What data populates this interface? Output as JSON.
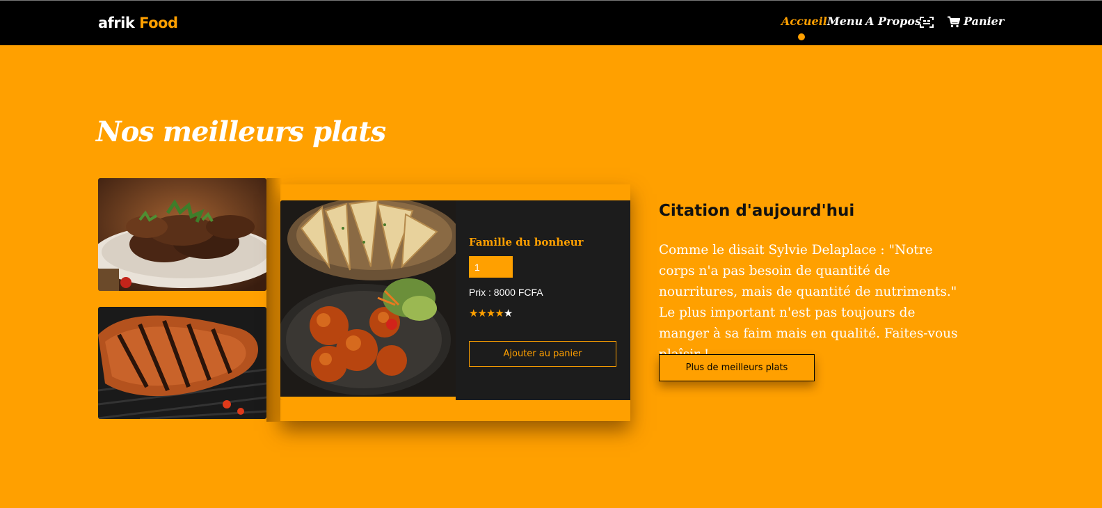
{
  "brand": {
    "part1": "afrik",
    "part2": "Food"
  },
  "nav": {
    "items": [
      {
        "label": "Accueil",
        "active": true
      },
      {
        "label": "Menu",
        "active": false
      },
      {
        "label": "A Propos",
        "active": false
      }
    ],
    "scan_icon": "qr-scan-icon",
    "cart_icon": "shopping-cart-icon",
    "cart_label": "Panier"
  },
  "section": {
    "title": "Nos meilleurs plats"
  },
  "featured": {
    "name": "Famille du bonheur",
    "quantity": "1",
    "price": "Prix : 8000 FCFA",
    "rating": 4,
    "rating_max": 5,
    "add_button": "Ajouter au panier"
  },
  "quote": {
    "title": "Citation d'aujourd'hui",
    "text": "Comme le disait Sylvie Delaplace : \"Notre corps n'a pas besoin de quantité de nourritures, mais de quantité de nutriments.\" Le plus important n'est pas toujours de manger à sa faim mais en qualité. Faites-vous plaîsir !",
    "button": "Plus de meilleurs plats"
  },
  "colors": {
    "accent": "#ffa000",
    "header_bg": "#000000",
    "card_bg": "#1c1c1c"
  }
}
